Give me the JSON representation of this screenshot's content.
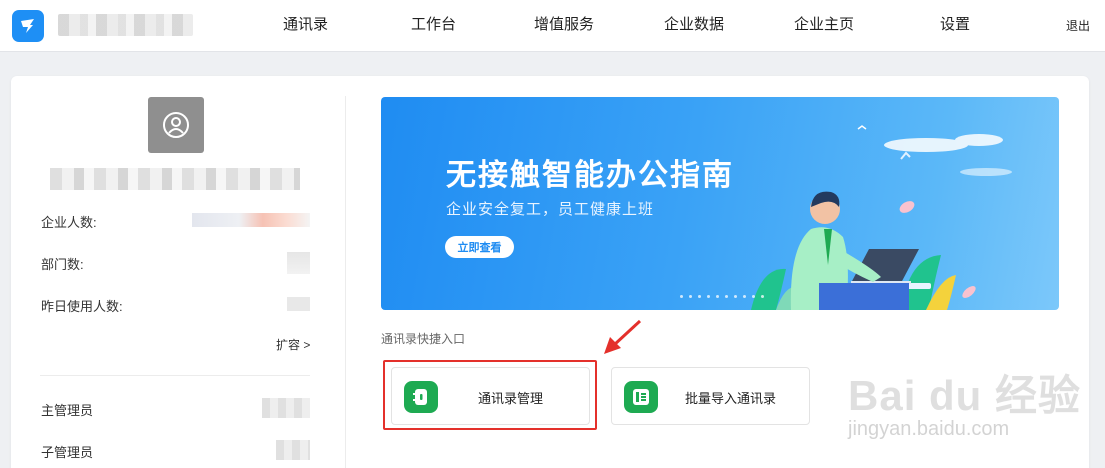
{
  "nav": {
    "items": [
      "通讯录",
      "工作台",
      "增值服务",
      "企业数据",
      "企业主页",
      "设置"
    ],
    "logout": "退出"
  },
  "left_panel": {
    "stats": [
      {
        "label": "企业人数:"
      },
      {
        "label": "部门数:"
      },
      {
        "label": "昨日使用人数:"
      }
    ],
    "expand": "扩容 >",
    "admins": [
      {
        "label": "主管理员"
      },
      {
        "label": "子管理员"
      }
    ]
  },
  "banner": {
    "title": "无接触智能办公指南",
    "subtitle": "企业安全复工，员工健康上班",
    "button": "立即查看"
  },
  "quick_entry": {
    "section_label": "通讯录快捷入口",
    "items": [
      {
        "label": "通讯录管理",
        "icon": "address-book-icon"
      },
      {
        "label": "批量导入通讯录",
        "icon": "import-book-icon"
      }
    ]
  },
  "watermark": {
    "text": "Bai du 经验",
    "sub": "jingyan.baidu.com"
  },
  "colors": {
    "brand_blue": "#1e8ff5",
    "entry_green": "#1eaa52",
    "highlight_red": "#e4302b"
  }
}
